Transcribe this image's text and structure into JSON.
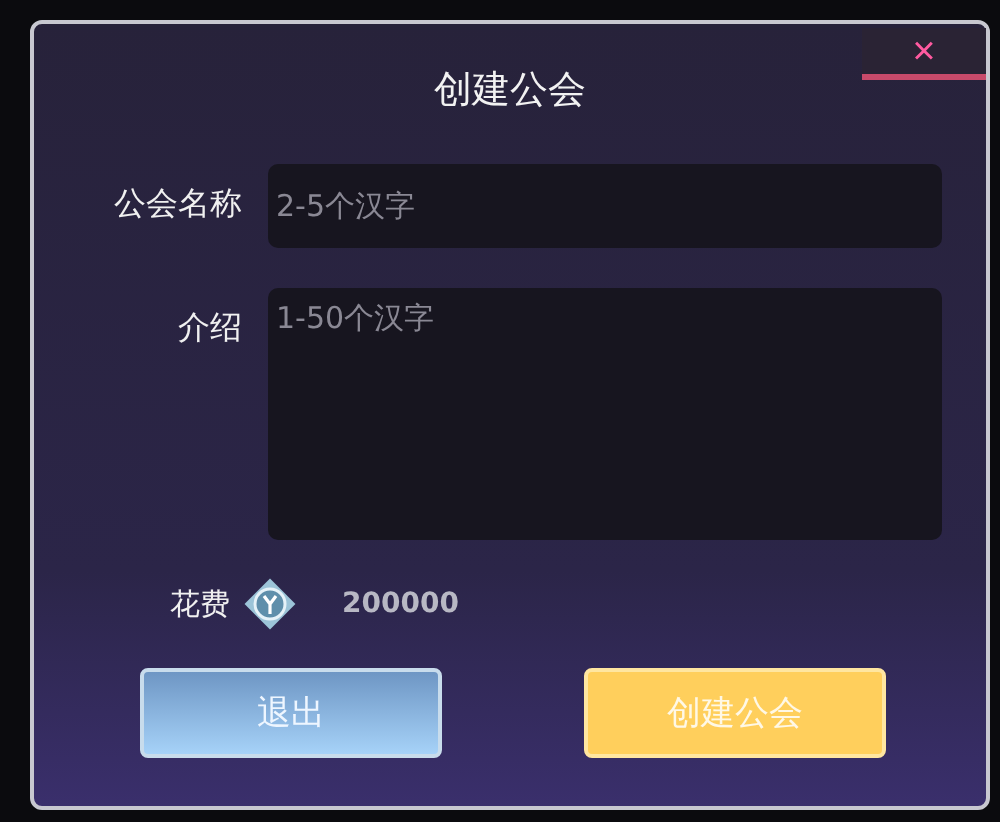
{
  "dialog": {
    "title": "创建公会",
    "close": "×"
  },
  "fields": [
    {
      "label": "公会名称",
      "placeholder": "2-5个汉字",
      "kind": "input"
    },
    {
      "label": "介绍",
      "placeholder": "1-50个汉字",
      "kind": "textarea"
    }
  ],
  "cost": {
    "label": "花费",
    "amount": "200000"
  },
  "buttons": [
    {
      "label": "退出",
      "kind": "secondary"
    },
    {
      "label": "创建公会",
      "kind": "primary"
    }
  ]
}
